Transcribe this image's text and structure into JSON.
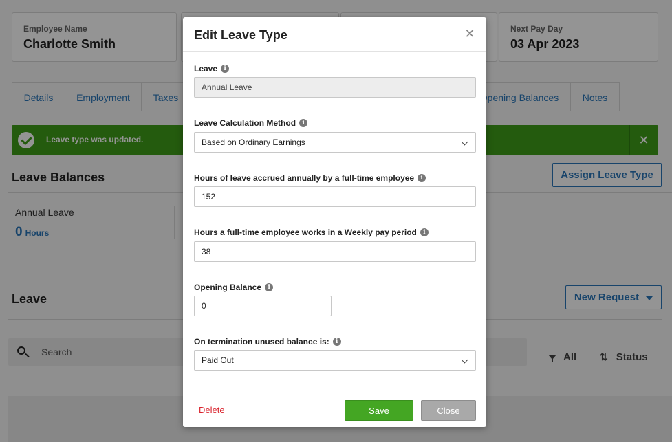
{
  "header_cards": [
    {
      "label": "Employee Name",
      "value": "Charlotte Smith"
    },
    {
      "label": "",
      "value": ""
    },
    {
      "label": "",
      "value": ""
    },
    {
      "label": "Next Pay Day",
      "value": "03 Apr 2023"
    }
  ],
  "tabs": [
    "Details",
    "Employment",
    "Taxes",
    "Opening Balances",
    "Notes"
  ],
  "alert": {
    "message": "Leave type was updated.",
    "close": "✕"
  },
  "leave_balances": {
    "title": "Leave Balances",
    "assign_button": "Assign Leave Type",
    "items": [
      {
        "label": "Annual Leave",
        "value": "0",
        "unit": "Hours"
      }
    ]
  },
  "leave": {
    "title": "Leave",
    "new_request_button": "New Request",
    "search_placeholder": "Search",
    "filter_all": "All",
    "filter_status": "Status"
  },
  "modal": {
    "title": "Edit Leave Type",
    "close_icon": "✕",
    "fields": {
      "leave": {
        "label": "Leave",
        "value": "Annual Leave"
      },
      "calc_method": {
        "label": "Leave Calculation Method",
        "value": "Based on Ordinary Earnings"
      },
      "hours_accrued": {
        "label": "Hours of leave accrued annually by a full-time employee",
        "value": "152"
      },
      "hours_worked": {
        "label": "Hours a full-time employee works in a Weekly pay period",
        "value": "38"
      },
      "opening_balance": {
        "label": "Opening Balance",
        "value": "0"
      },
      "termination": {
        "label": "On termination unused balance is:",
        "value": "Paid Out"
      }
    },
    "delete_label": "Delete",
    "save_label": "Save",
    "close_label": "Close"
  },
  "icons": {
    "info": "i"
  },
  "colors": {
    "accent": "#2a76b8",
    "success": "#3f9e19",
    "danger": "#d9232d"
  }
}
